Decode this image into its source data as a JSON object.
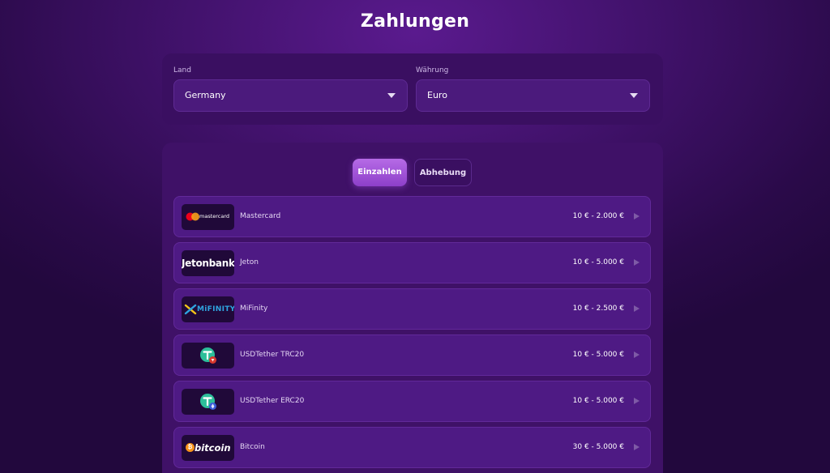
{
  "page": {
    "title": "Zahlungen"
  },
  "filters": {
    "country": {
      "label": "Land",
      "value": "Germany"
    },
    "currency": {
      "label": "Währung",
      "value": "Euro"
    }
  },
  "tabs": [
    {
      "label": "Einzahlen",
      "active": true
    },
    {
      "label": "Abhebung",
      "active": false
    }
  ],
  "methods": [
    {
      "name": "Mastercard",
      "limit": "10 € - 2.000 €",
      "logo_text": "mastercard"
    },
    {
      "name": "Jeton",
      "limit": "10 € - 5.000 €",
      "logo_text": "Jetonbank"
    },
    {
      "name": "MiFinity",
      "limit": "10 € - 2.500 €",
      "logo_text": "MiFINITY"
    },
    {
      "name": "USDTether TRC20",
      "limit": "10 € - 5.000 €",
      "logo_text": ""
    },
    {
      "name": "USDTether ERC20",
      "limit": "10 € - 5.000 €",
      "logo_text": ""
    },
    {
      "name": "Bitcoin",
      "limit": "30 € - 5.000 €",
      "logo_text": "bitcoin"
    }
  ],
  "colors": {
    "background": "#2a0a49",
    "card": "#3f1167",
    "row": "#4e1a84",
    "accent": "#9d4fd6",
    "tether": "#26a17b",
    "bitcoin": "#f7931a"
  },
  "icons": [
    "chevron-down-icon",
    "chevron-right-icon",
    "mastercard-logo",
    "jetonbank-logo",
    "mifinity-logo",
    "tether-trc20-logo",
    "tether-erc20-logo",
    "bitcoin-logo"
  ]
}
